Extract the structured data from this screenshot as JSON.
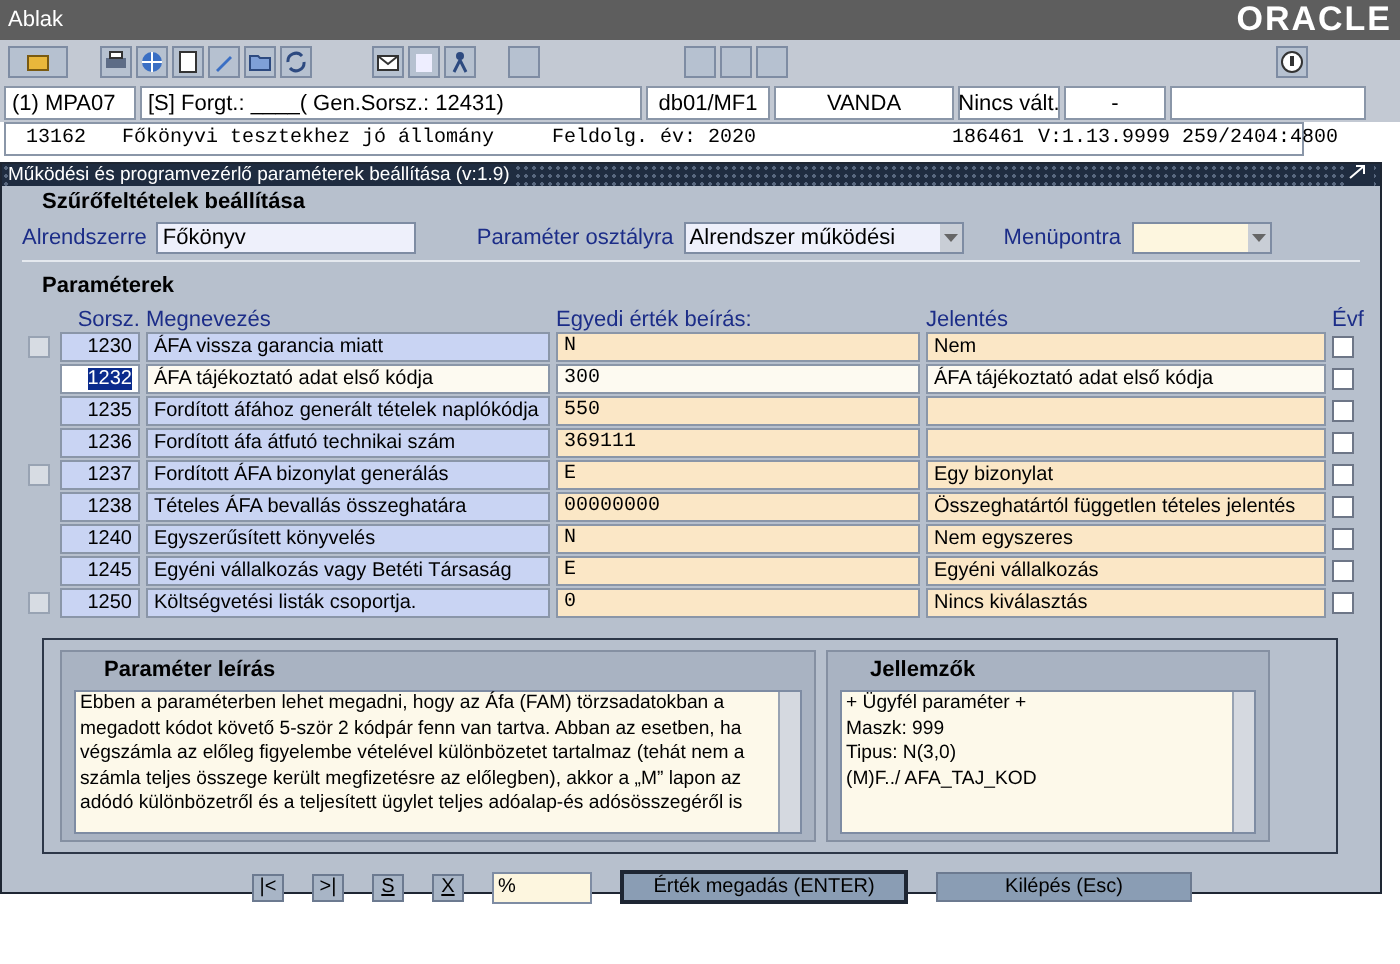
{
  "menu": {
    "items": [
      "Ablak"
    ],
    "logo": "ORACLE"
  },
  "info_bar": [
    "(1) MPA07",
    "[S] Forgt.: ____( Gen.Sorsz.: 12431)",
    "db01/MF1",
    "VANDA",
    "Nincs vált.",
    "-"
  ],
  "status_line": {
    "record": "13162   Főkönyvi tesztekhez jó állomány",
    "year": "Feldolg. év: 2020",
    "number": "186461",
    "version": "V:1.13.9999",
    "code": "259/2404:4800"
  },
  "window": {
    "title": "Működési és programvezérlő paraméterek beállítása (v:1.9)"
  },
  "filter": {
    "title": "Szűrőfeltételek beállítása",
    "fields": [
      {
        "label": "Alrendszerre",
        "value": "Főkönyv",
        "kind": "text"
      },
      {
        "label": "Paraméter osztályra",
        "value": "Alrendszer működési",
        "kind": "select"
      },
      {
        "label": "Menüpontra",
        "kind": "select"
      }
    ]
  },
  "params": {
    "title": "Paraméterek",
    "columns": [
      "Sorsz.",
      "Megnevezés",
      "Egyedi érték beírás:",
      "Jelentés",
      "Évf"
    ],
    "rows": [
      {
        "no": "1230",
        "name": "ÁFA vissza garancia miatt",
        "value": "N",
        "meaning": "Nem",
        "evf": false,
        "selected": false
      },
      {
        "no": "1232",
        "name": "ÁFA tájékoztató adat első kódja",
        "value": "300",
        "meaning": "ÁFA tájékoztató adat első kódja",
        "evf": false,
        "selected": true
      },
      {
        "no": "1235",
        "name": "Fordított áfához generált tételek naplókódja",
        "value": "550",
        "meaning": "",
        "evf": false,
        "selected": false
      },
      {
        "no": "1236",
        "name": "Fordított áfa átfutó technikai szám",
        "value": "369111",
        "meaning": "",
        "evf": false,
        "selected": false
      },
      {
        "no": "1237",
        "name": "Fordított ÁFA bizonylat generálás",
        "value": "E",
        "meaning": "Egy bizonylat",
        "evf": false,
        "selected": false
      },
      {
        "no": "1238",
        "name": "Tételes ÁFA bevallás összeghatára",
        "value": "00000000",
        "meaning": "Összeghatártól független tételes jelentés",
        "evf": false,
        "selected": false
      },
      {
        "no": "1240",
        "name": "Egyszerűsített könyvelés",
        "value": "N",
        "meaning": "Nem egyszeres",
        "evf": false,
        "selected": false
      },
      {
        "no": "1245",
        "name": "Egyéni vállalkozás vagy Betéti Társaság",
        "value": "E",
        "meaning": "Egyéni vállalkozás",
        "evf": false,
        "selected": false
      },
      {
        "no": "1250",
        "name": "Költségvetési listák csoportja.",
        "value": "0",
        "meaning": "Nincs kiválasztás",
        "evf": false,
        "selected": false
      }
    ]
  },
  "description": {
    "title": "Paraméter leírás",
    "text": "Ebben a paraméterben lehet megadni, hogy az Áfa (FAM) törzsadatokban a megadott kódot követő 5-ször 2 kódpár fenn van tartva. Abban az esetben, ha végszámla az előleg figyelembe vételével különbözetet tartalmaz (tehát nem a számla teljes összege került megfizetésre az előlegben), akkor a „M” lapon az adódó különbözetről és a teljesített ügylet teljes adóalap-és adósösszegéről is"
  },
  "characteristics": {
    "title": "Jellemzők",
    "lines": [
      "+ Ügyfél paraméter +",
      "Maszk: 999",
      "Tipus: N(3,0)",
      "(M)F../ AFA_TAJ_KOD"
    ]
  },
  "footer": {
    "nav": [
      "|<",
      ">|",
      "**S**",
      "**X**"
    ],
    "query": {
      "value": "%"
    },
    "buttons": [
      {
        "label": "Érték megadás (ENTER)",
        "focused": true
      },
      {
        "label": "Kilépés (Esc)",
        "focused": false
      }
    ]
  }
}
